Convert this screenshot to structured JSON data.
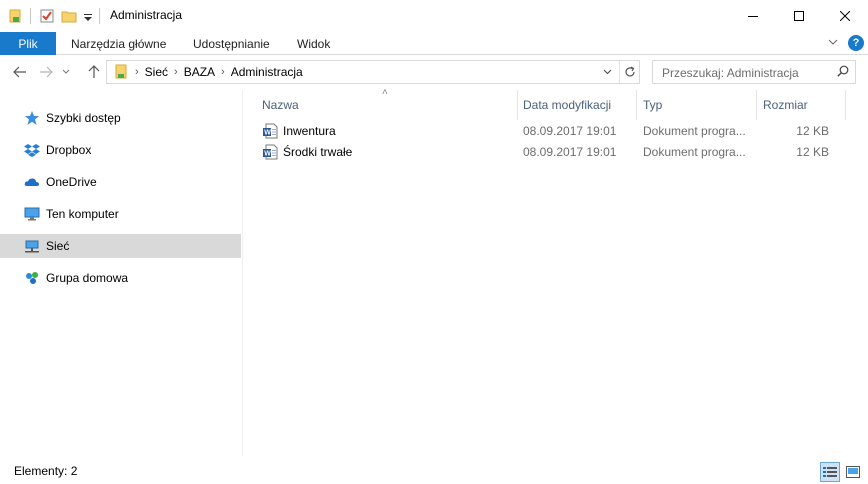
{
  "window": {
    "title": "Administracja",
    "minimize_glyph": "—",
    "maximize_glyph": "☐",
    "close_glyph": "✕"
  },
  "ribbon": {
    "tabs": [
      {
        "label": "Plik"
      },
      {
        "label": "Narzędzia główne"
      },
      {
        "label": "Udostępnianie"
      },
      {
        "label": "Widok"
      }
    ],
    "expand_glyph": "∨",
    "help_glyph": "?"
  },
  "nav": {
    "back_glyph": "←",
    "forward_glyph": "→",
    "recent_glyph": "∨",
    "up_glyph": "↑"
  },
  "address": {
    "crumbs": [
      "Sieć",
      "BAZA",
      "Administracja"
    ],
    "separator": "›",
    "dropdown_glyph": "∨",
    "refresh_glyph": "↻"
  },
  "search": {
    "placeholder": "Przeszukaj: Administracja"
  },
  "sidebar": {
    "items": [
      {
        "label": "Szybki dostęp",
        "icon": "star-icon"
      },
      {
        "label": "Dropbox",
        "icon": "dropbox-icon"
      },
      {
        "label": "OneDrive",
        "icon": "cloud-icon"
      },
      {
        "label": "Ten komputer",
        "icon": "computer-icon"
      },
      {
        "label": "Sieć",
        "icon": "network-icon",
        "selected": true
      },
      {
        "label": "Grupa domowa",
        "icon": "homegroup-icon"
      }
    ]
  },
  "columns": {
    "name": "Nazwa",
    "date": "Data modyfikacji",
    "type": "Typ",
    "size": "Rozmiar",
    "sort_glyph": "˄"
  },
  "files": [
    {
      "name": "Inwentura",
      "date": "08.09.2017 19:01",
      "type": "Dokument progra...",
      "size": "12 KB",
      "icon": "word-document-icon"
    },
    {
      "name": "Środki trwałe",
      "date": "08.09.2017 19:01",
      "type": "Dokument progra...",
      "size": "12 KB",
      "icon": "word-document-icon"
    }
  ],
  "status": {
    "count_text": "Elementy: 2"
  },
  "colors": {
    "accent": "#1979ca",
    "selection": "#d9d9d9",
    "header_text": "#4c607a"
  }
}
